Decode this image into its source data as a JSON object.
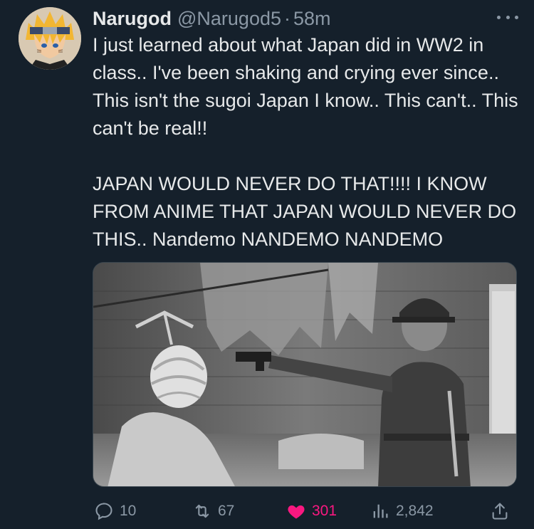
{
  "author": {
    "display_name": "Narugod",
    "handle": "@Narugod5",
    "separator": "·",
    "time": "58m",
    "avatar_icon": "anime-avatar-icon"
  },
  "tweet": {
    "paragraphs": [
      "I just learned about what Japan did in WW2 in class.. I've been shaking and crying ever since.. This isn't the sugoi Japan I know.. This can't.. This can't be real!!",
      "JAPAN WOULD NEVER DO THAT!!!! I KNOW FROM ANIME THAT JAPAN WOULD NEVER DO THIS.. Nandemo NANDEMO NANDEMO"
    ]
  },
  "media": {
    "type": "black-and-white photo"
  },
  "actions": {
    "replies": "10",
    "retweets": "67",
    "likes": "301",
    "views": "2,842"
  },
  "colors": {
    "background": "#15202b",
    "text": "#e7e9ea",
    "muted": "#8b98a5",
    "like": "#f91880"
  },
  "icons": {
    "reply": "reply-icon",
    "retweet": "retweet-icon",
    "like": "heart-icon",
    "views": "views-icon",
    "share": "share-icon",
    "more": "more-icon"
  }
}
